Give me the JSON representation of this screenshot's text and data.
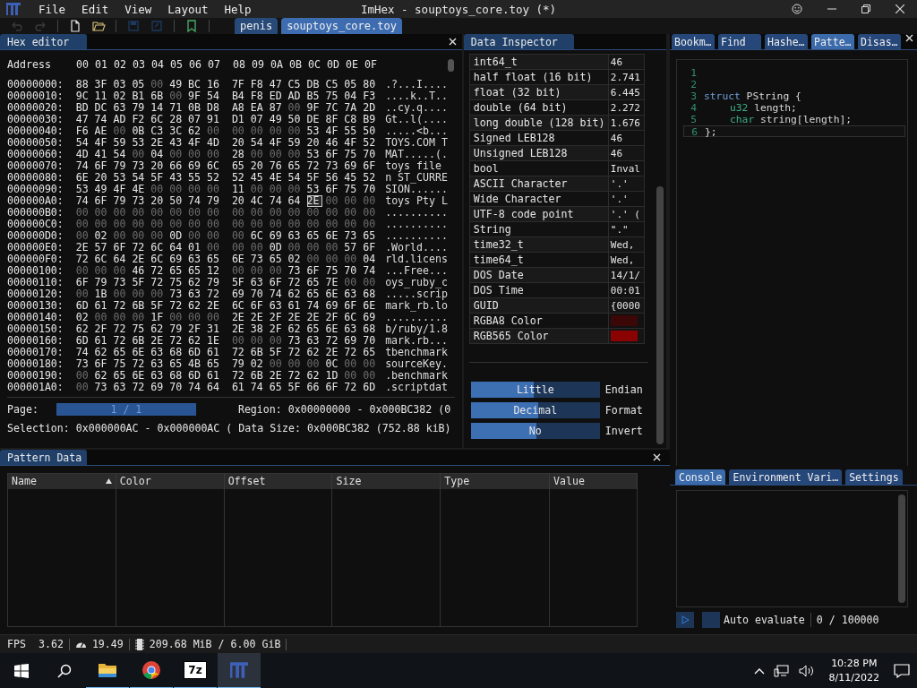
{
  "menu": [
    "File",
    "Edit",
    "View",
    "Layout",
    "Help"
  ],
  "window": {
    "title": "ImHex - souptoys_core.toy (*)"
  },
  "toolbar": [
    {
      "kind": "undo",
      "disabled": true
    },
    {
      "kind": "redo",
      "disabled": true
    },
    {
      "kind": "new-file",
      "disabled": false
    },
    {
      "kind": "open",
      "disabled": false
    },
    {
      "kind": "save",
      "disabled": true
    },
    {
      "kind": "save-as",
      "disabled": true
    },
    {
      "kind": "bookmark",
      "disabled": false
    }
  ],
  "file_tabs": [
    {
      "label": "penis",
      "selected": false
    },
    {
      "label": "souptoys_core.toy",
      "selected": true
    }
  ],
  "hex_editor": {
    "title": "Hex editor",
    "address_label": "Address",
    "columns": [
      "00",
      "01",
      "02",
      "03",
      "04",
      "05",
      "06",
      "07",
      "08",
      "09",
      "0A",
      "0B",
      "0C",
      "0D",
      "0E",
      "0F"
    ],
    "rows": [
      {
        "address": "00000000:",
        "bytes": [
          "88",
          "3F",
          "03",
          "05",
          "00",
          "49",
          "BC",
          "16",
          "7F",
          "F8",
          "47",
          "C5",
          "DB",
          "C5",
          "05",
          "80"
        ],
        "ascii": ".?...I...."
      },
      {
        "address": "00000010:",
        "bytes": [
          "9C",
          "11",
          "02",
          "B1",
          "6B",
          "00",
          "9F",
          "54",
          "B4",
          "F8",
          "ED",
          "AD",
          "B5",
          "75",
          "04",
          "F3"
        ],
        "ascii": "....k..T.."
      },
      {
        "address": "00000020:",
        "bytes": [
          "BD",
          "DC",
          "63",
          "79",
          "14",
          "71",
          "0B",
          "D8",
          "A8",
          "EA",
          "87",
          "00",
          "9F",
          "7C",
          "7A",
          "2D"
        ],
        "ascii": "..cy.q...."
      },
      {
        "address": "00000030:",
        "bytes": [
          "47",
          "74",
          "AD",
          "F2",
          "6C",
          "28",
          "07",
          "91",
          "D1",
          "07",
          "49",
          "50",
          "DE",
          "8F",
          "C8",
          "B9"
        ],
        "ascii": "Gt..l(...."
      },
      {
        "address": "00000040:",
        "bytes": [
          "F6",
          "AE",
          "00",
          "0B",
          "C3",
          "3C",
          "62",
          "00",
          "00",
          "00",
          "00",
          "00",
          "53",
          "4F",
          "55",
          "50"
        ],
        "ascii": ".....<b..."
      },
      {
        "address": "00000050:",
        "bytes": [
          "54",
          "4F",
          "59",
          "53",
          "2E",
          "43",
          "4F",
          "4D",
          "20",
          "54",
          "4F",
          "59",
          "20",
          "46",
          "4F",
          "52"
        ],
        "ascii": "TOYS.COM T"
      },
      {
        "address": "00000060:",
        "bytes": [
          "4D",
          "41",
          "54",
          "00",
          "04",
          "00",
          "00",
          "00",
          "28",
          "00",
          "00",
          "00",
          "53",
          "6F",
          "75",
          "70"
        ],
        "ascii": "MAT.....(."
      },
      {
        "address": "00000070:",
        "bytes": [
          "74",
          "6F",
          "79",
          "73",
          "20",
          "66",
          "69",
          "6C",
          "65",
          "20",
          "76",
          "65",
          "72",
          "73",
          "69",
          "6F"
        ],
        "ascii": "toys file "
      },
      {
        "address": "00000080:",
        "bytes": [
          "6E",
          "20",
          "53",
          "54",
          "5F",
          "43",
          "55",
          "52",
          "52",
          "45",
          "4E",
          "54",
          "5F",
          "56",
          "45",
          "52"
        ],
        "ascii": "n ST_CURRE"
      },
      {
        "address": "00000090:",
        "bytes": [
          "53",
          "49",
          "4F",
          "4E",
          "00",
          "00",
          "00",
          "00",
          "11",
          "00",
          "00",
          "00",
          "53",
          "6F",
          "75",
          "70"
        ],
        "ascii": "SION......"
      },
      {
        "address": "000000A0:",
        "bytes": [
          "74",
          "6F",
          "79",
          "73",
          "20",
          "50",
          "74",
          "79",
          "20",
          "4C",
          "74",
          "64",
          {
            "value": "2E",
            "selected": true
          },
          "00",
          "00",
          "00"
        ],
        "ascii": "toys Pty L"
      },
      {
        "address": "000000B0:",
        "bytes": [
          "00",
          "00",
          "00",
          "00",
          "00",
          "00",
          "00",
          "00",
          "00",
          "00",
          "00",
          "00",
          "00",
          "00",
          "00",
          "00"
        ],
        "ascii": ".........."
      },
      {
        "address": "000000C0:",
        "bytes": [
          "00",
          "00",
          "00",
          "00",
          "00",
          "00",
          "00",
          "00",
          "00",
          "00",
          "00",
          "00",
          "00",
          "00",
          "00",
          "00"
        ],
        "ascii": ".........."
      },
      {
        "address": "000000D0:",
        "bytes": [
          "00",
          "02",
          "00",
          "00",
          "00",
          "0D",
          "00",
          "00",
          "00",
          "6C",
          "69",
          "63",
          "65",
          "6E",
          "73",
          "65"
        ],
        "ascii": ".........."
      },
      {
        "address": "000000E0:",
        "bytes": [
          "2E",
          "57",
          "6F",
          "72",
          "6C",
          "64",
          "01",
          "00",
          "00",
          "00",
          "0D",
          "00",
          "00",
          "00",
          "57",
          "6F"
        ],
        "ascii": ".World...."
      },
      {
        "address": "000000F0:",
        "bytes": [
          "72",
          "6C",
          "64",
          "2E",
          "6C",
          "69",
          "63",
          "65",
          "6E",
          "73",
          "65",
          "02",
          "00",
          "00",
          "00",
          "04"
        ],
        "ascii": "rld.licens"
      },
      {
        "address": "00000100:",
        "bytes": [
          "00",
          "00",
          "00",
          "46",
          "72",
          "65",
          "65",
          "12",
          "00",
          "00",
          "00",
          "73",
          "6F",
          "75",
          "70",
          "74"
        ],
        "ascii": "...Free..."
      },
      {
        "address": "00000110:",
        "bytes": [
          "6F",
          "79",
          "73",
          "5F",
          "72",
          "75",
          "62",
          "79",
          "5F",
          "63",
          "6F",
          "72",
          "65",
          "7E",
          "00",
          "00"
        ],
        "ascii": "oys_ruby_c"
      },
      {
        "address": "00000120:",
        "bytes": [
          "00",
          "1B",
          "00",
          "00",
          "00",
          "73",
          "63",
          "72",
          "69",
          "70",
          "74",
          "62",
          "65",
          "6E",
          "63",
          "68"
        ],
        "ascii": ".....scrip"
      },
      {
        "address": "00000130:",
        "bytes": [
          "6D",
          "61",
          "72",
          "6B",
          "5F",
          "72",
          "62",
          "2E",
          "6C",
          "6F",
          "63",
          "61",
          "74",
          "69",
          "6F",
          "6E"
        ],
        "ascii": "mark_rb.lo"
      },
      {
        "address": "00000140:",
        "bytes": [
          "02",
          "00",
          "00",
          "00",
          "1F",
          "00",
          "00",
          "00",
          "2E",
          "2E",
          "2F",
          "2E",
          "2E",
          "2F",
          "6C",
          "69"
        ],
        "ascii": ".........."
      },
      {
        "address": "00000150:",
        "bytes": [
          "62",
          "2F",
          "72",
          "75",
          "62",
          "79",
          "2F",
          "31",
          "2E",
          "38",
          "2F",
          "62",
          "65",
          "6E",
          "63",
          "68"
        ],
        "ascii": "b/ruby/1.8"
      },
      {
        "address": "00000160:",
        "bytes": [
          "6D",
          "61",
          "72",
          "6B",
          "2E",
          "72",
          "62",
          "1E",
          "00",
          "00",
          "00",
          "73",
          "63",
          "72",
          "69",
          "70"
        ],
        "ascii": "mark.rb..."
      },
      {
        "address": "00000170:",
        "bytes": [
          "74",
          "62",
          "65",
          "6E",
          "63",
          "68",
          "6D",
          "61",
          "72",
          "6B",
          "5F",
          "72",
          "62",
          "2E",
          "72",
          "65"
        ],
        "ascii": "tbenchmark"
      },
      {
        "address": "00000180:",
        "bytes": [
          "73",
          "6F",
          "75",
          "72",
          "63",
          "65",
          "4B",
          "65",
          "79",
          "02",
          "00",
          "00",
          "00",
          "0C",
          "00",
          "00"
        ],
        "ascii": "sourceKey."
      },
      {
        "address": "00000190:",
        "bytes": [
          "00",
          "62",
          "65",
          "6E",
          "63",
          "68",
          "6D",
          "61",
          "72",
          "6B",
          "2E",
          "72",
          "62",
          "1D",
          "00",
          "00"
        ],
        "ascii": ".benchmark"
      },
      {
        "address": "000001A0:",
        "bytes": [
          "00",
          "73",
          "63",
          "72",
          "69",
          "70",
          "74",
          "64",
          "61",
          "74",
          "65",
          "5F",
          "66",
          "6F",
          "72",
          "6D"
        ],
        "ascii": ".scriptdat"
      }
    ],
    "page_label": "Page:",
    "page_slider": {
      "text": "1 / 1",
      "level": 1
    },
    "region": "Region: 0x00000000 - 0x000BC382 (0",
    "selection": "Selection: 0x000000AC - 0x000000AC ( Data Size: 0x000BC382 (752.88 kiB)"
  },
  "data_inspector": {
    "title": "Data Inspector",
    "rows": [
      {
        "kind": "text",
        "name": "int64_t",
        "value": "46"
      },
      {
        "kind": "text",
        "name": "half float (16 bit)",
        "value": "2.741"
      },
      {
        "kind": "text",
        "name": "float (32 bit)",
        "value": "6.445"
      },
      {
        "kind": "text",
        "name": "double (64 bit)",
        "value": "2.272"
      },
      {
        "kind": "text",
        "name": "long double (128 bit)",
        "value": "1.676"
      },
      {
        "kind": "text",
        "name": "Signed LEB128",
        "value": "46"
      },
      {
        "kind": "text",
        "name": "Unsigned LEB128",
        "value": "46"
      },
      {
        "kind": "text",
        "name": "bool",
        "value": "Inval"
      },
      {
        "kind": "text",
        "name": "ASCII Character",
        "value": "'.'"
      },
      {
        "kind": "text",
        "name": "Wide Character",
        "value": "'.'"
      },
      {
        "kind": "text",
        "name": "UTF-8 code point",
        "value": "'.' ("
      },
      {
        "kind": "text",
        "name": "String",
        "value": "\".\""
      },
      {
        "kind": "text",
        "name": "time32_t",
        "value": "Wed,"
      },
      {
        "kind": "text",
        "name": "time64_t",
        "value": "Wed,"
      },
      {
        "kind": "text",
        "name": "DOS Date",
        "value": "14/1/"
      },
      {
        "kind": "text",
        "name": "DOS Time",
        "value": "00:01"
      },
      {
        "kind": "text",
        "name": "GUID",
        "value": "{0000"
      },
      {
        "kind": "color",
        "name": "RGBA8 Color",
        "color": "#3c0707"
      },
      {
        "kind": "color",
        "name": "RGB565 Color",
        "color": "#8a0202"
      }
    ],
    "settings": [
      {
        "value": "Little",
        "label": "Endian",
        "level": 0.49
      },
      {
        "value": "Decimal",
        "label": "Format",
        "level": 0.52
      },
      {
        "value": "No",
        "label": "Invert",
        "level": 0.51
      }
    ]
  },
  "tool_tabs": [
    {
      "label": "Bookm…",
      "selected": false
    },
    {
      "label": "Find",
      "selected": false
    },
    {
      "label": "Hashe…",
      "selected": false
    },
    {
      "label": "Patte…",
      "selected": true
    },
    {
      "label": "Disas…",
      "selected": false
    }
  ],
  "pattern_editor": {
    "lines": [
      {
        "number": "1",
        "current": false
      },
      {
        "number": "2",
        "current": false
      },
      {
        "number": "3",
        "current": false,
        "indented": false,
        "tokens": [
          {
            "kind": "keyword",
            "text": "struct"
          },
          {
            "kind": "plain",
            "text": " PString {"
          }
        ]
      },
      {
        "number": "4",
        "current": false,
        "indented": true,
        "tokens": [
          {
            "kind": "type",
            "text": "u32"
          },
          {
            "kind": "plain",
            "text": " length;"
          }
        ]
      },
      {
        "number": "5",
        "current": false,
        "indented": true,
        "tokens": [
          {
            "kind": "type",
            "text": "char"
          },
          {
            "kind": "plain",
            "text": " string[length];"
          }
        ]
      },
      {
        "number": "6",
        "current": true,
        "indented": false,
        "tokens": [
          {
            "kind": "plain",
            "text": "};"
          }
        ]
      }
    ]
  },
  "console_tabs": [
    {
      "label": "Console",
      "selected": true
    },
    {
      "label": "Environment Vari…",
      "selected": false
    },
    {
      "label": "Settings",
      "selected": false
    }
  ],
  "console": {
    "auto_evaluate": {
      "label": "Auto evaluate",
      "checked": false
    },
    "counter": "0 / 100000"
  },
  "pattern_data": {
    "title": "Pattern Data",
    "columns": [
      {
        "label": "Name",
        "sorted": true
      },
      {
        "label": "Color",
        "sorted": false
      },
      {
        "label": "Offset",
        "sorted": false
      },
      {
        "label": "Size",
        "sorted": false
      },
      {
        "label": "Type",
        "sorted": false
      },
      {
        "label": "Value",
        "sorted": false
      }
    ]
  },
  "status_bar": {
    "fps_label": "FPS",
    "fps": "3.62",
    "frame_time": "19.49",
    "memory": "209.68 MiB / 6.00 GiB"
  },
  "taskbar": {
    "apps": [
      {
        "kind": "folder",
        "running": true,
        "active": false
      },
      {
        "kind": "browser",
        "running": true,
        "active": false
      },
      {
        "kind": "archiver",
        "label": "7z",
        "running": true,
        "active": false
      },
      {
        "kind": "hex-editor",
        "running": true,
        "active": true
      }
    ],
    "time": "10:28 PM",
    "date": "8/11/2022"
  }
}
